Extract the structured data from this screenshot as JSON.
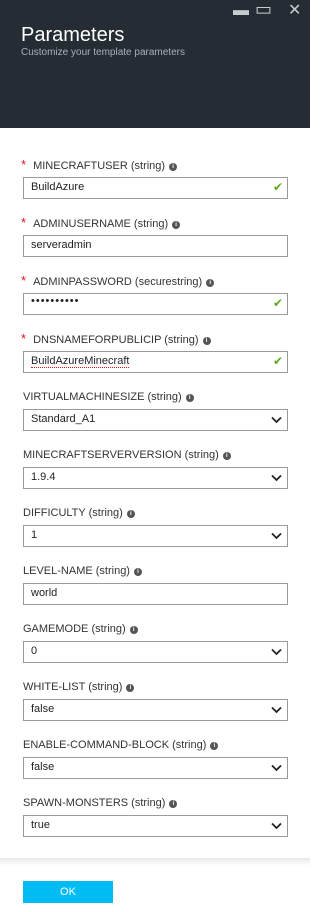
{
  "header": {
    "title": "Parameters",
    "subtitle": "Customize your template parameters",
    "minimize": "▬",
    "maximize": "▭",
    "close": "✕"
  },
  "fields": [
    {
      "label": "MINECRAFTUSER (string)",
      "required": true,
      "value": "BuildAzure",
      "control": "text",
      "valid": true
    },
    {
      "label": "ADMINUSERNAME (string)",
      "required": true,
      "value": "serveradmin",
      "control": "text",
      "valid": false
    },
    {
      "label": "ADMINPASSWORD (securestring)",
      "required": true,
      "value": "••••••••••",
      "control": "password",
      "valid": true
    },
    {
      "label": "DNSNAMEFORPUBLICIP (string)",
      "required": true,
      "value": "BuildAzureMinecraft",
      "control": "text",
      "valid": true
    },
    {
      "label": "VIRTUALMACHINESIZE (string)",
      "required": false,
      "value": "Standard_A1",
      "control": "select"
    },
    {
      "label": "MINECRAFTSERVERVERSION (string)",
      "required": false,
      "value": "1.9.4",
      "control": "select"
    },
    {
      "label": "DIFFICULTY (string)",
      "required": false,
      "value": "1",
      "control": "select"
    },
    {
      "label": "LEVEL-NAME (string)",
      "required": false,
      "value": "world",
      "control": "text",
      "valid": false
    },
    {
      "label": "GAMEMODE (string)",
      "required": false,
      "value": "0",
      "control": "select"
    },
    {
      "label": "WHITE-LIST (string)",
      "required": false,
      "value": "false",
      "control": "select"
    },
    {
      "label": "ENABLE-COMMAND-BLOCK (string)",
      "required": false,
      "value": "false",
      "control": "select"
    },
    {
      "label": "SPAWN-MONSTERS (string)",
      "required": false,
      "value": "true",
      "control": "select"
    }
  ],
  "footer": {
    "ok_label": "OK"
  },
  "colors": {
    "header_bg": "#262c33",
    "required": "#e81123",
    "valid_check": "#5ea81f",
    "ok_button": "#00bcf2"
  }
}
